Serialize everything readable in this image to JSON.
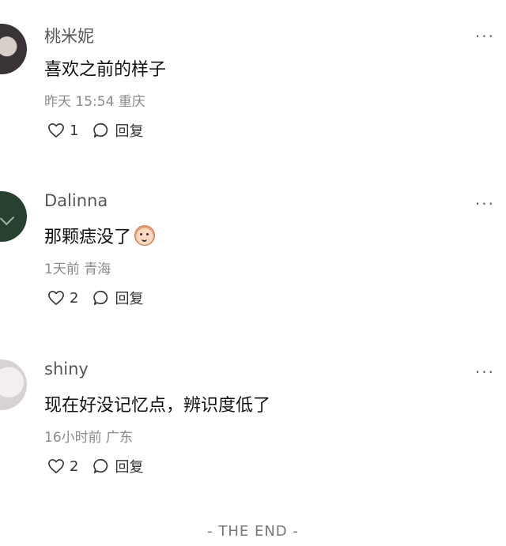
{
  "comments": [
    {
      "username": "桃米妮",
      "text": "喜欢之前的样子",
      "meta": "昨天 15:54 重庆",
      "like_count": "1",
      "reply_label": "回复",
      "more_label": "···"
    },
    {
      "username": "Dalinna",
      "text": "那颗痣没了",
      "meta": "1天前 青海",
      "like_count": "2",
      "reply_label": "回复",
      "more_label": "···"
    },
    {
      "username": "shiny",
      "text": "现在好没记忆点，辨识度低了",
      "meta": "16小时前 广东",
      "like_count": "2",
      "reply_label": "回复",
      "more_label": "···"
    }
  ],
  "footer": "- THE END -",
  "icons": {
    "like": "heart-outline-icon",
    "reply": "speech-bubble-icon",
    "more": "more-dots-icon"
  }
}
